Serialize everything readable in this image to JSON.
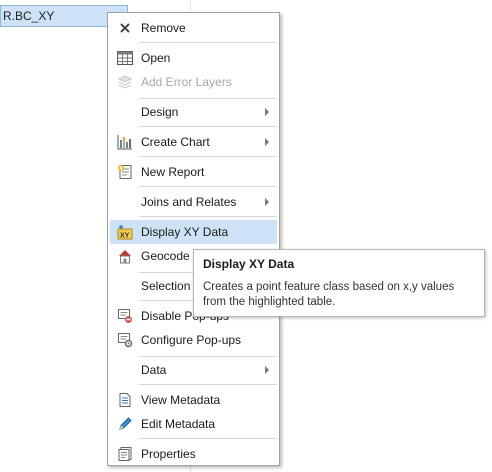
{
  "tree": {
    "selected_item": "R.BC_XY"
  },
  "menu": {
    "items": [
      {
        "label": "Remove",
        "icon": "close-icon"
      },
      {
        "label": "Open",
        "icon": "table-icon"
      },
      {
        "label": "Add Error Layers",
        "icon": "layers-icon",
        "disabled": true
      },
      {
        "label": "Design",
        "submenu": true
      },
      {
        "label": "Create Chart",
        "icon": "chart-icon",
        "submenu": true
      },
      {
        "label": "New Report",
        "icon": "report-icon"
      },
      {
        "label": "Joins and Relates",
        "submenu": true
      },
      {
        "label": "Display XY Data",
        "icon": "xy-data-icon",
        "highlighted": true
      },
      {
        "label": "Geocode",
        "icon": "geocode-icon"
      },
      {
        "label": "Selection"
      },
      {
        "label": "Disable Pop-ups",
        "icon": "popup-disable-icon"
      },
      {
        "label": "Configure Pop-ups",
        "icon": "popup-configure-icon"
      },
      {
        "label": "Data",
        "submenu": true
      },
      {
        "label": "View Metadata",
        "icon": "metadata-view-icon"
      },
      {
        "label": "Edit Metadata",
        "icon": "pencil-icon"
      },
      {
        "label": "Properties",
        "icon": "properties-icon"
      }
    ]
  },
  "tooltip": {
    "title": "Display XY Data",
    "body": "Creates a point feature class based on x,y values from the highlighted table."
  },
  "colors": {
    "highlight": "#cde3f5",
    "accent": "#2e7bbf"
  }
}
